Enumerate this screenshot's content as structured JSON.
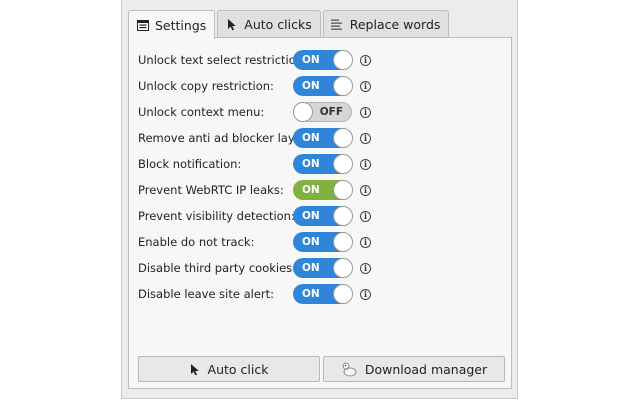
{
  "tabs": [
    {
      "label": "Settings",
      "icon": "settings-list-icon",
      "active": true
    },
    {
      "label": "Auto clicks",
      "icon": "cursor-icon",
      "active": false
    },
    {
      "label": "Replace words",
      "icon": "text-lines-icon",
      "active": false
    }
  ],
  "settings": [
    {
      "label": "Unlock text select restriction:",
      "state": "ON"
    },
    {
      "label": "Unlock copy restriction:",
      "state": "ON"
    },
    {
      "label": "Unlock context menu:",
      "state": "OFF"
    },
    {
      "label": "Remove anti ad blocker layer:",
      "state": "ON"
    },
    {
      "label": "Block notification:",
      "state": "ON"
    },
    {
      "label": "Prevent WebRTC IP leaks:",
      "state": "ON"
    },
    {
      "label": "Prevent visibility detection:",
      "state": "ON"
    },
    {
      "label": "Enable do not track:",
      "state": "ON"
    },
    {
      "label": "Disable third party cookies:",
      "state": "ON"
    },
    {
      "label": "Disable leave site alert:",
      "state": "ON"
    }
  ],
  "info_glyph": "i",
  "buttons": {
    "auto_click": "Auto click",
    "download_manager": "Download manager"
  },
  "colors": {
    "toggle_on": "#2f86d8",
    "toggle_on_webrtc": "#7fb23e",
    "toggle_off": "#d5d5d5"
  }
}
